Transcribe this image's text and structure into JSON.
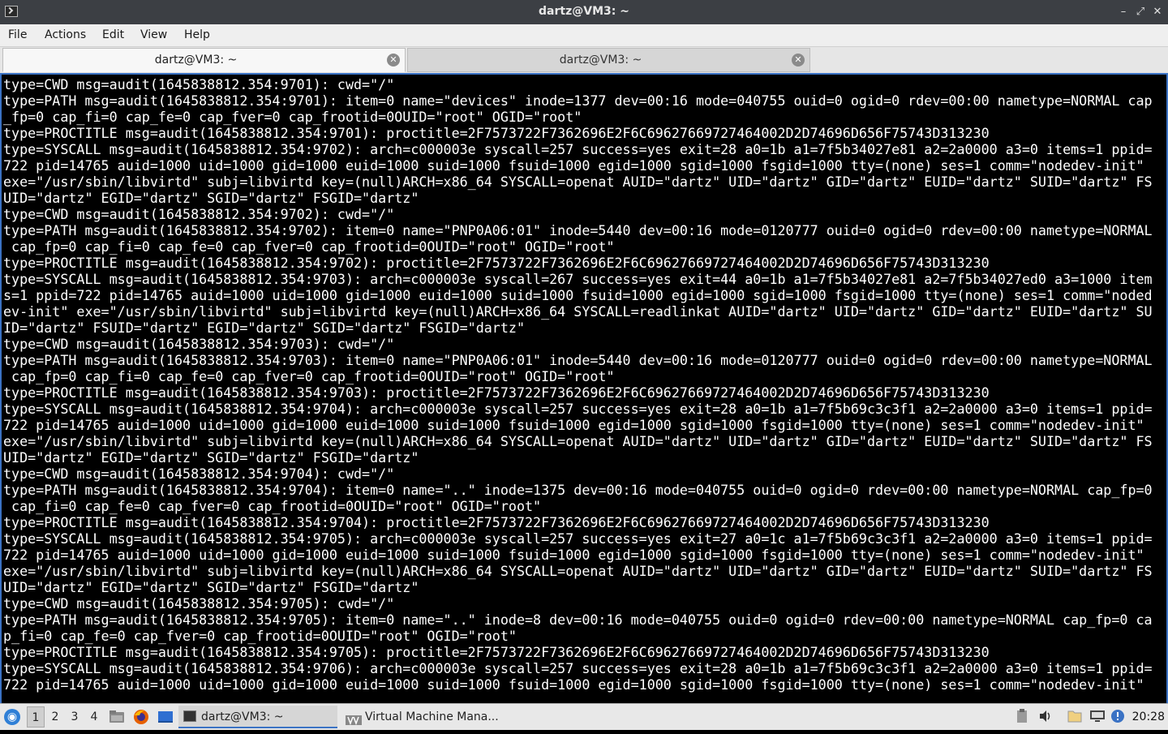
{
  "window": {
    "title": "dartz@VM3: ~",
    "minimize": "–",
    "maximize": "⤢",
    "close": "✕"
  },
  "menu": [
    "File",
    "Actions",
    "Edit",
    "View",
    "Help"
  ],
  "tabs": [
    {
      "label": "dartz@VM3: ~",
      "close": "✕"
    },
    {
      "label": "dartz@VM3: ~",
      "close": "✕"
    }
  ],
  "terminal": {
    "lines": [
      "type=CWD msg=audit(1645838812.354:9701): cwd=\"/\"",
      "type=PATH msg=audit(1645838812.354:9701): item=0 name=\"devices\" inode=1377 dev=00:16 mode=040755 ouid=0 ogid=0 rdev=00:00 nametype=NORMAL cap",
      "_fp=0 cap_fi=0 cap_fe=0 cap_fver=0 cap_frootid=0OUID=\"root\" OGID=\"root\"",
      "type=PROCTITLE msg=audit(1645838812.354:9701): proctitle=2F7573722F7362696E2F6C69627669727464002D2D74696D656F75743D313230",
      "type=SYSCALL msg=audit(1645838812.354:9702): arch=c000003e syscall=257 success=yes exit=28 a0=1b a1=7f5b34027e81 a2=2a0000 a3=0 items=1 ppid=",
      "722 pid=14765 auid=1000 uid=1000 gid=1000 euid=1000 suid=1000 fsuid=1000 egid=1000 sgid=1000 fsgid=1000 tty=(none) ses=1 comm=\"nodedev-init\"",
      "exe=\"/usr/sbin/libvirtd\" subj=libvirtd key=(null)ARCH=x86_64 SYSCALL=openat AUID=\"dartz\" UID=\"dartz\" GID=\"dartz\" EUID=\"dartz\" SUID=\"dartz\" FS",
      "UID=\"dartz\" EGID=\"dartz\" SGID=\"dartz\" FSGID=\"dartz\"",
      "type=CWD msg=audit(1645838812.354:9702): cwd=\"/\"",
      "type=PATH msg=audit(1645838812.354:9702): item=0 name=\"PNP0A06:01\" inode=5440 dev=00:16 mode=0120777 ouid=0 ogid=0 rdev=00:00 nametype=NORMAL",
      " cap_fp=0 cap_fi=0 cap_fe=0 cap_fver=0 cap_frootid=0OUID=\"root\" OGID=\"root\"",
      "type=PROCTITLE msg=audit(1645838812.354:9702): proctitle=2F7573722F7362696E2F6C69627669727464002D2D74696D656F75743D313230",
      "type=SYSCALL msg=audit(1645838812.354:9703): arch=c000003e syscall=267 success=yes exit=44 a0=1b a1=7f5b34027e81 a2=7f5b34027ed0 a3=1000 item",
      "s=1 ppid=722 pid=14765 auid=1000 uid=1000 gid=1000 euid=1000 suid=1000 fsuid=1000 egid=1000 sgid=1000 fsgid=1000 tty=(none) ses=1 comm=\"noded",
      "ev-init\" exe=\"/usr/sbin/libvirtd\" subj=libvirtd key=(null)ARCH=x86_64 SYSCALL=readlinkat AUID=\"dartz\" UID=\"dartz\" GID=\"dartz\" EUID=\"dartz\" SU",
      "ID=\"dartz\" FSUID=\"dartz\" EGID=\"dartz\" SGID=\"dartz\" FSGID=\"dartz\"",
      "type=CWD msg=audit(1645838812.354:9703): cwd=\"/\"",
      "type=PATH msg=audit(1645838812.354:9703): item=0 name=\"PNP0A06:01\" inode=5440 dev=00:16 mode=0120777 ouid=0 ogid=0 rdev=00:00 nametype=NORMAL",
      " cap_fp=0 cap_fi=0 cap_fe=0 cap_fver=0 cap_frootid=0OUID=\"root\" OGID=\"root\"",
      "type=PROCTITLE msg=audit(1645838812.354:9703): proctitle=2F7573722F7362696E2F6C69627669727464002D2D74696D656F75743D313230",
      "type=SYSCALL msg=audit(1645838812.354:9704): arch=c000003e syscall=257 success=yes exit=28 a0=1b a1=7f5b69c3c3f1 a2=2a0000 a3=0 items=1 ppid=",
      "722 pid=14765 auid=1000 uid=1000 gid=1000 euid=1000 suid=1000 fsuid=1000 egid=1000 sgid=1000 fsgid=1000 tty=(none) ses=1 comm=\"nodedev-init\"",
      "exe=\"/usr/sbin/libvirtd\" subj=libvirtd key=(null)ARCH=x86_64 SYSCALL=openat AUID=\"dartz\" UID=\"dartz\" GID=\"dartz\" EUID=\"dartz\" SUID=\"dartz\" FS",
      "UID=\"dartz\" EGID=\"dartz\" SGID=\"dartz\" FSGID=\"dartz\"",
      "type=CWD msg=audit(1645838812.354:9704): cwd=\"/\"",
      "type=PATH msg=audit(1645838812.354:9704): item=0 name=\"..\" inode=1375 dev=00:16 mode=040755 ouid=0 ogid=0 rdev=00:00 nametype=NORMAL cap_fp=0",
      " cap_fi=0 cap_fe=0 cap_fver=0 cap_frootid=0OUID=\"root\" OGID=\"root\"",
      "type=PROCTITLE msg=audit(1645838812.354:9704): proctitle=2F7573722F7362696E2F6C69627669727464002D2D74696D656F75743D313230",
      "type=SYSCALL msg=audit(1645838812.354:9705): arch=c000003e syscall=257 success=yes exit=27 a0=1c a1=7f5b69c3c3f1 a2=2a0000 a3=0 items=1 ppid=",
      "722 pid=14765 auid=1000 uid=1000 gid=1000 euid=1000 suid=1000 fsuid=1000 egid=1000 sgid=1000 fsgid=1000 tty=(none) ses=1 comm=\"nodedev-init\"",
      "exe=\"/usr/sbin/libvirtd\" subj=libvirtd key=(null)ARCH=x86_64 SYSCALL=openat AUID=\"dartz\" UID=\"dartz\" GID=\"dartz\" EUID=\"dartz\" SUID=\"dartz\" FS",
      "UID=\"dartz\" EGID=\"dartz\" SGID=\"dartz\" FSGID=\"dartz\"",
      "type=CWD msg=audit(1645838812.354:9705): cwd=\"/\"",
      "type=PATH msg=audit(1645838812.354:9705): item=0 name=\"..\" inode=8 dev=00:16 mode=040755 ouid=0 ogid=0 rdev=00:00 nametype=NORMAL cap_fp=0 ca",
      "p_fi=0 cap_fe=0 cap_fver=0 cap_frootid=0OUID=\"root\" OGID=\"root\"",
      "type=PROCTITLE msg=audit(1645838812.354:9705): proctitle=2F7573722F7362696E2F6C69627669727464002D2D74696D656F75743D313230",
      "type=SYSCALL msg=audit(1645838812.354:9706): arch=c000003e syscall=257 success=yes exit=28 a0=1b a1=7f5b69c3c3f1 a2=2a0000 a3=0 items=1 ppid=",
      "722 pid=14765 auid=1000 uid=1000 gid=1000 euid=1000 suid=1000 fsuid=1000 egid=1000 sgid=1000 fsgid=1000 tty=(none) ses=1 comm=\"nodedev-init\""
    ]
  },
  "taskbar": {
    "start_icon": "lxqt-start-icon",
    "workspaces": [
      "1",
      "2",
      "3",
      "4"
    ],
    "active_workspace": "1",
    "quicklaunch": [
      "file-manager-icon",
      "firefox-icon",
      "desktop-icon"
    ],
    "tasks": [
      {
        "label": "dartz@VM3: ~",
        "icon": "terminal-icon",
        "active": true
      },
      {
        "label": "Virtual Machine Mana...",
        "icon": "virt-manager-icon",
        "active": false
      }
    ],
    "tray": [
      "clipboard-icon",
      "volume-icon",
      "removable-media-icon",
      "network-icon",
      "update-notifier-icon"
    ],
    "clock": "20:28"
  },
  "colors": {
    "titlebar": "#3c3f44",
    "terminal_bg": "#000000",
    "terminal_fg": "#ffffff",
    "focus_border": "#3a72c4"
  }
}
